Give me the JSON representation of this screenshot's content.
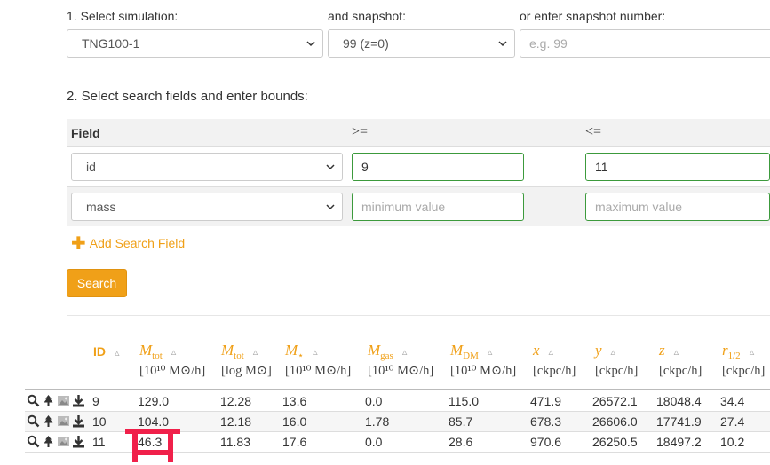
{
  "step1": {
    "title": "1. Select simulation:",
    "simulation_value": "TNG100-1",
    "snapshot_label": "and snapshot:",
    "snapshot_value": "99 (z=0)",
    "snapnum_label": "or enter snapshot number:",
    "snapnum_placeholder": "e.g. 99"
  },
  "step2": {
    "title": "2. Select search fields and enter bounds:",
    "col_field": "Field",
    "col_ge": ">=",
    "col_le": "<=",
    "rows": [
      {
        "field": "id",
        "min_value": "9",
        "min_placeholder": "",
        "max_value": "11",
        "max_placeholder": ""
      },
      {
        "field": "mass",
        "min_value": "",
        "min_placeholder": "minimum value",
        "max_value": "",
        "max_placeholder": "maximum value"
      }
    ],
    "add_field_label": "Add Search Field",
    "search_button": "Search"
  },
  "results": {
    "columns": [
      {
        "sym": "ID",
        "sub": "",
        "unit": ""
      },
      {
        "sym": "M",
        "sub": "tot",
        "unit": "[10¹⁰ M⊙/h]"
      },
      {
        "sym": "M",
        "sub": "tot",
        "unit": "[log M⊙]"
      },
      {
        "sym": "M",
        "sub": "⋆",
        "unit": "[10¹⁰ M⊙/h]"
      },
      {
        "sym": "M",
        "sub": "gas",
        "unit": "[10¹⁰ M⊙/h]"
      },
      {
        "sym": "M",
        "sub": "DM",
        "unit": "[10¹⁰ M⊙/h]"
      },
      {
        "sym": "x",
        "sub": "",
        "unit": "[ckpc/h]"
      },
      {
        "sym": "y",
        "sub": "",
        "unit": "[ckpc/h]"
      },
      {
        "sym": "z",
        "sub": "",
        "unit": "[ckpc/h]"
      },
      {
        "sym": "r",
        "sub": "1/2",
        "unit": "[ckpc/h]"
      }
    ],
    "rows": [
      [
        "9",
        "129.0",
        "12.28",
        "13.6",
        "0.0",
        "115.0",
        "471.9",
        "26572.1",
        "18048.4",
        "34.4"
      ],
      [
        "10",
        "104.0",
        "12.18",
        "16.0",
        "1.78",
        "85.7",
        "678.3",
        "26606.0",
        "17741.9",
        "27.4"
      ],
      [
        "11",
        "46.3",
        "11.83",
        "17.6",
        "0.0",
        "28.6",
        "970.6",
        "26250.5",
        "18497.2",
        "10.2"
      ]
    ]
  },
  "icons": [
    "search-icon",
    "tree-icon",
    "image-icon",
    "download-icon"
  ],
  "colors": {
    "accent": "#f0a018",
    "valid_border": "#3c9a3c",
    "annotation": "#f0204a"
  }
}
